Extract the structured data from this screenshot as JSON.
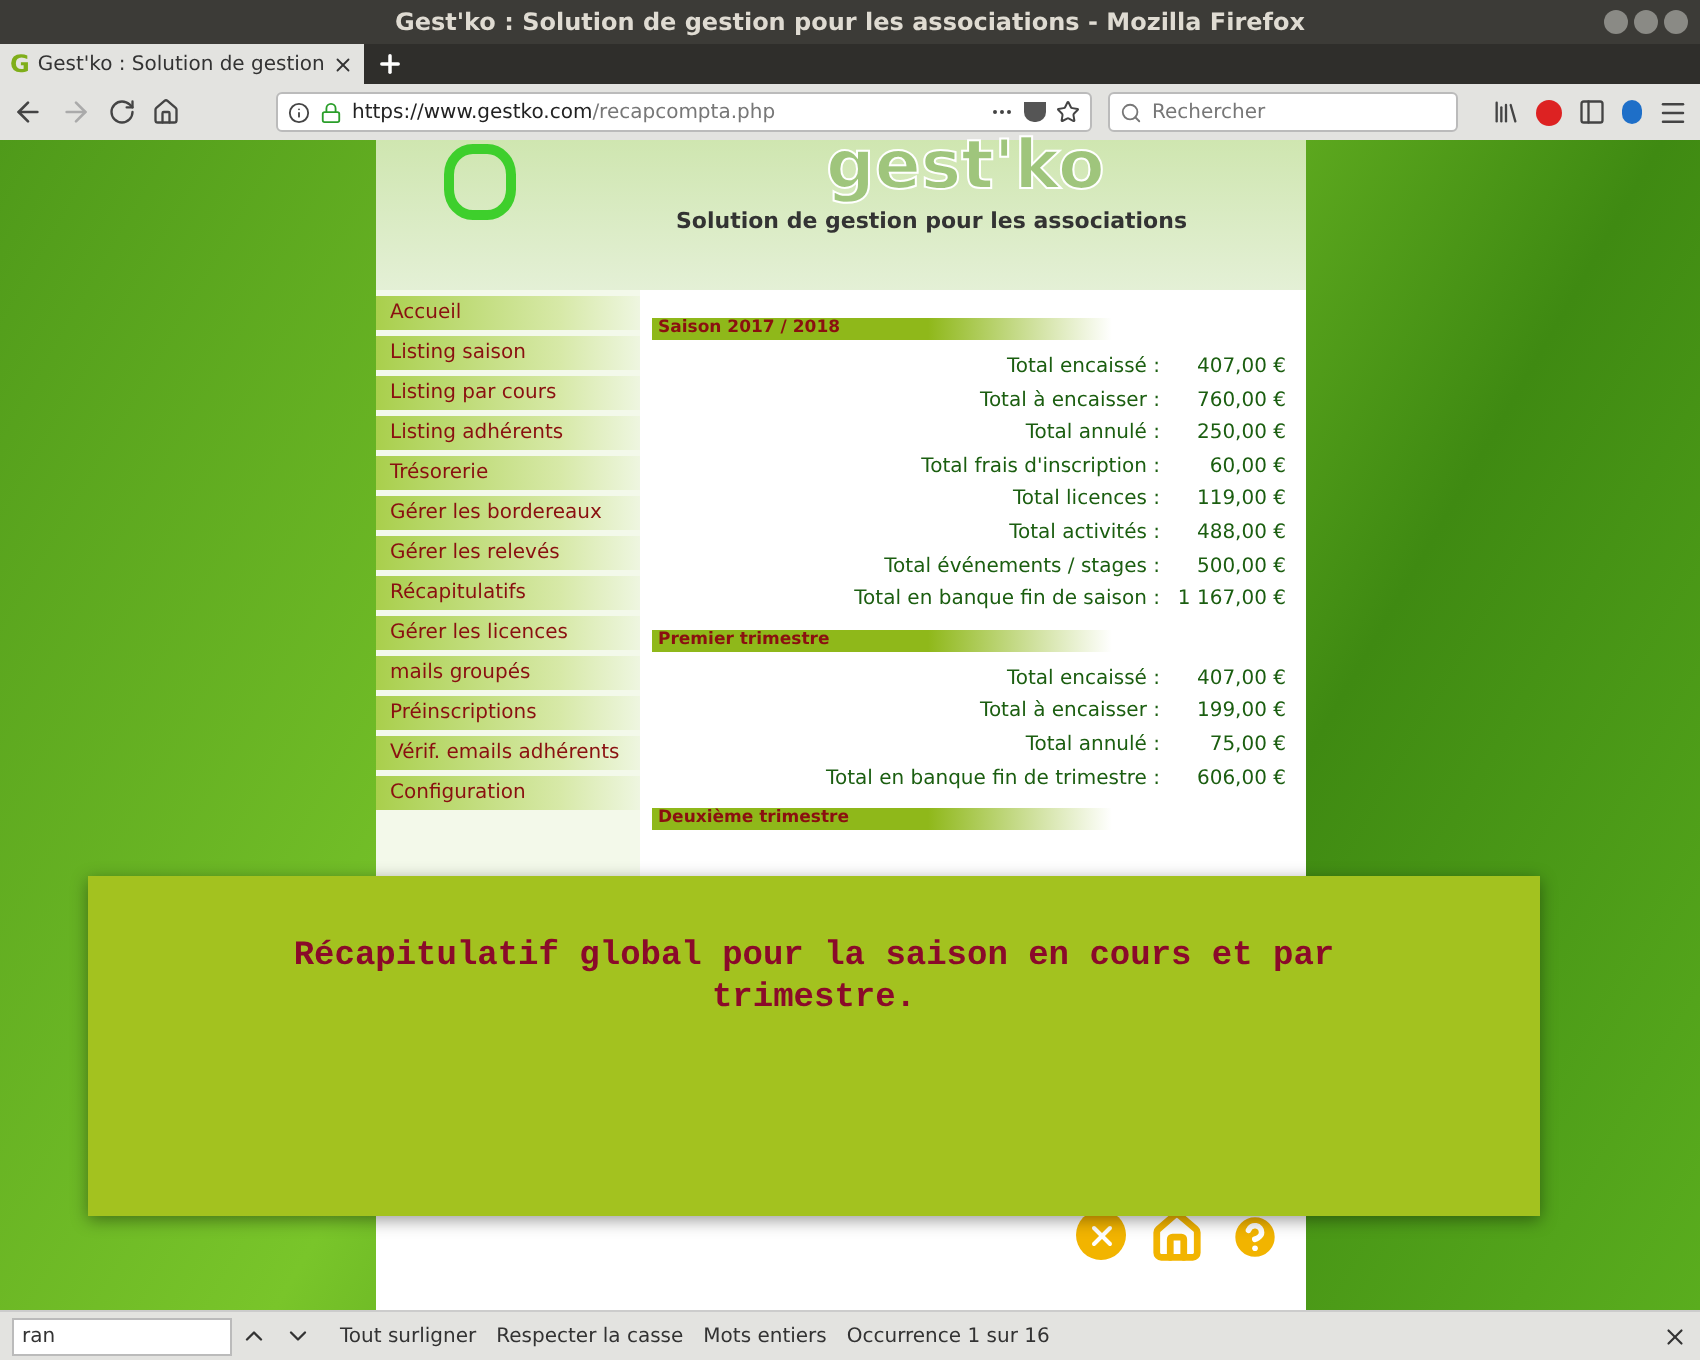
{
  "window": {
    "title": "Gest'ko : Solution de gestion pour les associations - Mozilla Firefox"
  },
  "tab": {
    "favicon": "G",
    "title": "Gest'ko : Solution de gestion",
    "selected": true
  },
  "address_bar": {
    "host": "https://www.gestko.com",
    "path": "/recapcompta.php"
  },
  "search": {
    "placeholder": "Rechercher"
  },
  "page": {
    "logo_text": "gest'ko",
    "tagline": "Solution de gestion pour les associations",
    "menu": [
      "Accueil",
      "Listing saison",
      "Listing par cours",
      "Listing adhérents",
      "Trésorerie",
      "Gérer les bordereaux",
      "Gérer les relevés",
      "Récapitulatifs",
      "Gérer les licences",
      "mails groupés",
      "Préinscriptions",
      "Vérif. emails adhérents",
      "Configuration"
    ],
    "sections": [
      {
        "title": "Saison 2017 / 2018",
        "rows": [
          {
            "label": "Total encaissé :",
            "value": "407,00 €"
          },
          {
            "label": "Total à encaisser :",
            "value": "760,00 €"
          },
          {
            "label": "Total annulé :",
            "value": "250,00 €"
          },
          {
            "label": "Total frais d'inscription :",
            "value": "60,00 €"
          },
          {
            "label": "Total licences :",
            "value": "119,00 €"
          },
          {
            "label": "Total activités :",
            "value": "488,00 €"
          },
          {
            "label": "Total événements / stages :",
            "value": "500,00 €"
          },
          {
            "label": "Total en banque fin de saison :",
            "value": "1 167,00 €"
          }
        ]
      },
      {
        "title": "Premier trimestre",
        "rows": [
          {
            "label": "Total encaissé :",
            "value": "407,00 €"
          },
          {
            "label": "Total à encaisser :",
            "value": "199,00 €"
          },
          {
            "label": "Total annulé :",
            "value": "75,00 €"
          },
          {
            "label": "Total en banque fin de trimestre :",
            "value": "606,00 €"
          }
        ]
      },
      {
        "title": "Deuxième trimestre"
      }
    ],
    "overlay": {
      "text": "Récapitulatif global pour la saison en cours et par trimestre."
    }
  },
  "find_bar": {
    "value": "ran",
    "options": [
      "Tout surligner",
      "Respecter la casse",
      "Mots entiers"
    ],
    "status": "Occurrence 1 sur 16"
  }
}
